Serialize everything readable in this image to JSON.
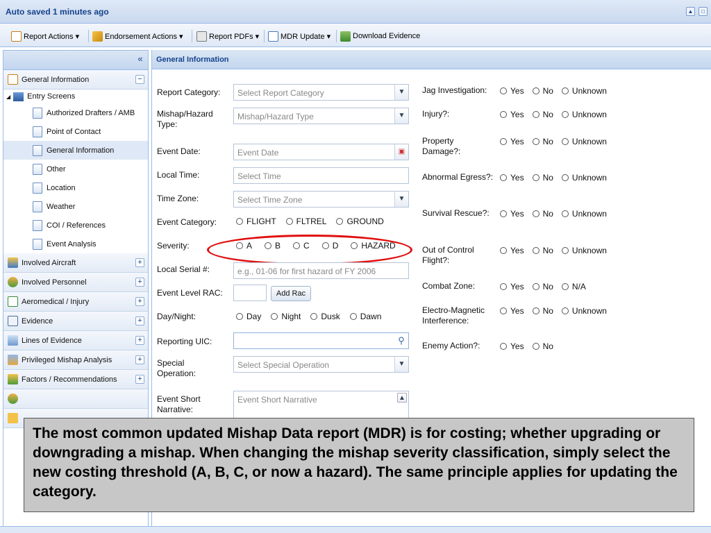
{
  "titlebar": {
    "title": "Auto saved 1 minutes ago"
  },
  "toolbar": {
    "items": [
      {
        "label": "Report Actions ▾"
      },
      {
        "label": "Endorsement Actions ▾"
      },
      {
        "label": "Report PDFs ▾"
      },
      {
        "label": "MDR Update ▾"
      },
      {
        "label": "Download Evidence"
      }
    ]
  },
  "sidebar": {
    "collapse_glyph": "«",
    "general_information": "General Information",
    "entry_screens": "Entry Screens",
    "leaves": [
      "Authorized Drafters / AMB",
      "Point of Contact",
      "General Information",
      "Other",
      "Location",
      "Weather",
      "COI / References",
      "Event Analysis"
    ],
    "sections": [
      "Involved Aircraft",
      "Involved Personnel",
      "Aeromedical / Injury",
      "Evidence",
      "Lines of Evidence",
      "Privileged Mishap Analysis",
      "Factors / Recommendations"
    ]
  },
  "main": {
    "header": "General Information",
    "report_category": {
      "label": "Report Category:",
      "placeholder": "Select Report Category"
    },
    "mishap_type": {
      "label": "Mishap/Hazard Type:",
      "placeholder": "Mishap/Hazard Type"
    },
    "event_date": {
      "label": "Event Date:",
      "placeholder": "Event Date"
    },
    "local_time": {
      "label": "Local Time:",
      "placeholder": "Select Time"
    },
    "time_zone": {
      "label": "Time Zone:",
      "placeholder": "Select Time Zone"
    },
    "event_category": {
      "label": "Event Category:",
      "options": [
        "FLIGHT",
        "FLTREL",
        "GROUND"
      ]
    },
    "severity": {
      "label": "Severity:",
      "options": [
        "A",
        "B",
        "C",
        "D",
        "HAZARD"
      ]
    },
    "local_serial": {
      "label": "Local Serial #:",
      "placeholder": "e.g., 01-06 for first hazard of FY 2006"
    },
    "event_level_rac": {
      "label": "Event Level RAC:",
      "button": "Add Rac"
    },
    "day_night": {
      "label": "Day/Night:",
      "options": [
        "Day",
        "Night",
        "Dusk",
        "Dawn"
      ]
    },
    "reporting_uic": {
      "label": "Reporting UIC:"
    },
    "special_operation": {
      "label": "Special Operation:",
      "placeholder": "Select Special Operation"
    },
    "event_short_narrative": {
      "label": "Event Short Narrative:",
      "placeholder": "Event Short Narrative"
    },
    "right_questions": [
      {
        "label": "Jag Investigation:",
        "options": [
          "Yes",
          "No",
          "Unknown"
        ]
      },
      {
        "label": "Injury?:",
        "options": [
          "Yes",
          "No",
          "Unknown"
        ]
      },
      {
        "label": "Property Damage?:",
        "options": [
          "Yes",
          "No",
          "Unknown"
        ]
      },
      {
        "label": "Abnormal Egress?:",
        "options": [
          "Yes",
          "No",
          "Unknown"
        ]
      },
      {
        "label": "Survival Rescue?:",
        "options": [
          "Yes",
          "No",
          "Unknown"
        ]
      },
      {
        "label": "Out of Control Flight?:",
        "options": [
          "Yes",
          "No",
          "Unknown"
        ]
      },
      {
        "label": "Combat Zone:",
        "options": [
          "Yes",
          "No",
          "N/A"
        ]
      },
      {
        "label": "Electro-Magnetic Interference:",
        "options": [
          "Yes",
          "No",
          "Unknown"
        ]
      },
      {
        "label": "Enemy Action?:",
        "options": [
          "Yes",
          "No"
        ]
      }
    ]
  },
  "caption": "The most common updated Mishap Data report (MDR) is for costing; whether upgrading or downgrading a mishap.  When changing the mishap severity classification, simply select the new costing threshold (A, B, C, or now a hazard).  The same principle applies for updating the category.",
  "colors": {
    "accent": "#15428b",
    "highlight": "#e01010",
    "caption_bg": "#c7c7c7"
  }
}
